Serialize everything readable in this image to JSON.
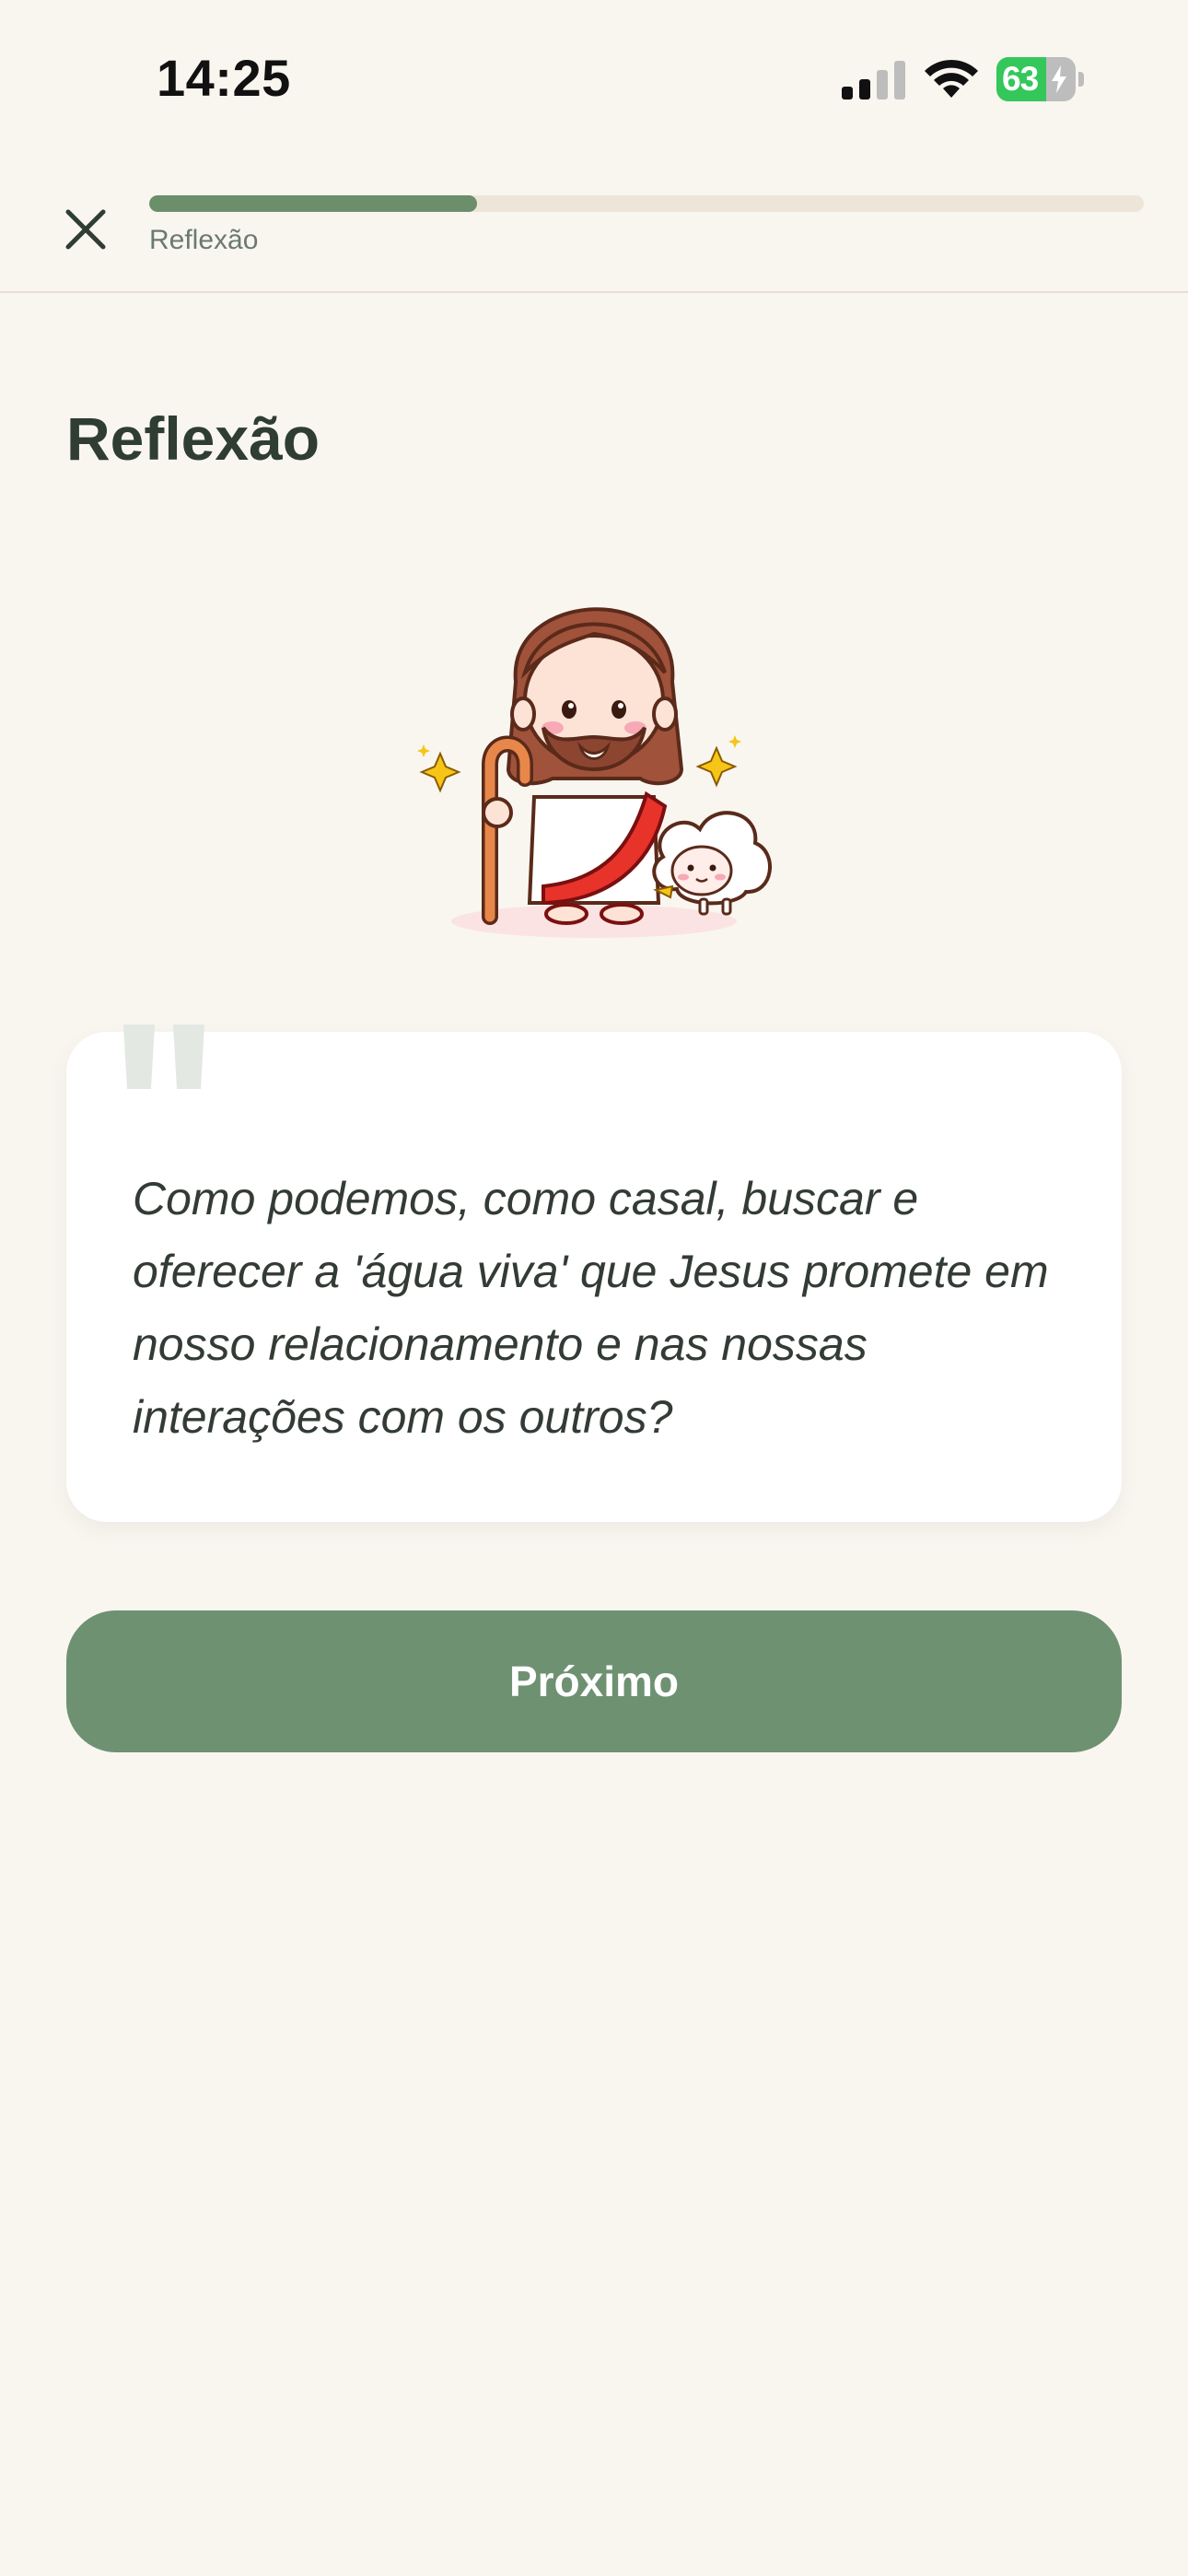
{
  "status_bar": {
    "time": "14:25",
    "battery_percent": "63",
    "battery_level": 0.63,
    "icons": [
      "signal-icon",
      "wifi-icon",
      "battery-icon",
      "charging-bolt-icon"
    ]
  },
  "header": {
    "close_icon": "close-icon",
    "progress_label": "Reflexão",
    "progress_fraction": 0.33
  },
  "page": {
    "title": "Reflexão",
    "illustration": "jesus-with-lamb-illustration"
  },
  "quote": {
    "icon": "quote-mark-icon",
    "text": "Como podemos, como casal, buscar e oferecer a 'água viva' que Jesus promete em nosso relacionamento e nas nossas interações com os outros?"
  },
  "actions": {
    "next_label": "Próximo"
  },
  "colors": {
    "background": "#F9F6F0",
    "accent": "#6E9172",
    "progress_track": "#EEE5D9",
    "title": "#2F3D33",
    "card": "#FFFFFF",
    "battery_green": "#34C759"
  }
}
